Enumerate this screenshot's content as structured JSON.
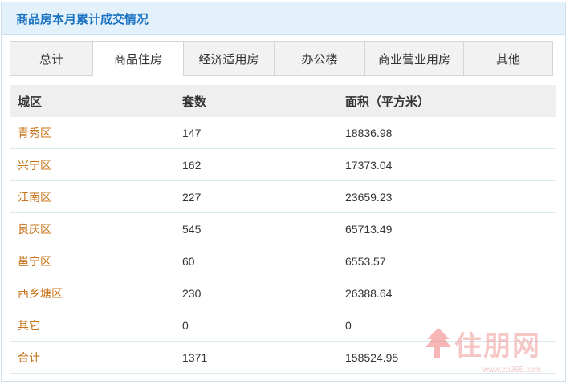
{
  "header": {
    "title": "商品房本月累计成交情况"
  },
  "tabs": [
    {
      "label": "总计",
      "active": false
    },
    {
      "label": "商品住房",
      "active": true
    },
    {
      "label": "经济适用房",
      "active": false
    },
    {
      "label": "办公楼",
      "active": false
    },
    {
      "label": "商业营业用房",
      "active": false
    },
    {
      "label": "其他",
      "active": false
    }
  ],
  "table": {
    "columns": [
      "城区",
      "套数",
      "面积（平方米）"
    ],
    "rows": [
      {
        "city": "青秀区",
        "units": "147",
        "area": "18836.98"
      },
      {
        "city": "兴宁区",
        "units": "162",
        "area": "17373.04"
      },
      {
        "city": "江南区",
        "units": "227",
        "area": "23659.23"
      },
      {
        "city": "良庆区",
        "units": "545",
        "area": "65713.49"
      },
      {
        "city": "邕宁区",
        "units": "60",
        "area": "6553.57"
      },
      {
        "city": "西乡塘区",
        "units": "230",
        "area": "26388.64"
      },
      {
        "city": "其它",
        "units": "0",
        "area": "0"
      },
      {
        "city": "合计",
        "units": "1371",
        "area": "158524.95"
      }
    ]
  },
  "watermark": {
    "brand": "住朋网",
    "url": "www.zp365.com"
  },
  "colors": {
    "header_bg": "#e3f1fb",
    "title": "#1a72c2",
    "city": "#c8741a",
    "row_border": "#dbe9f3"
  }
}
